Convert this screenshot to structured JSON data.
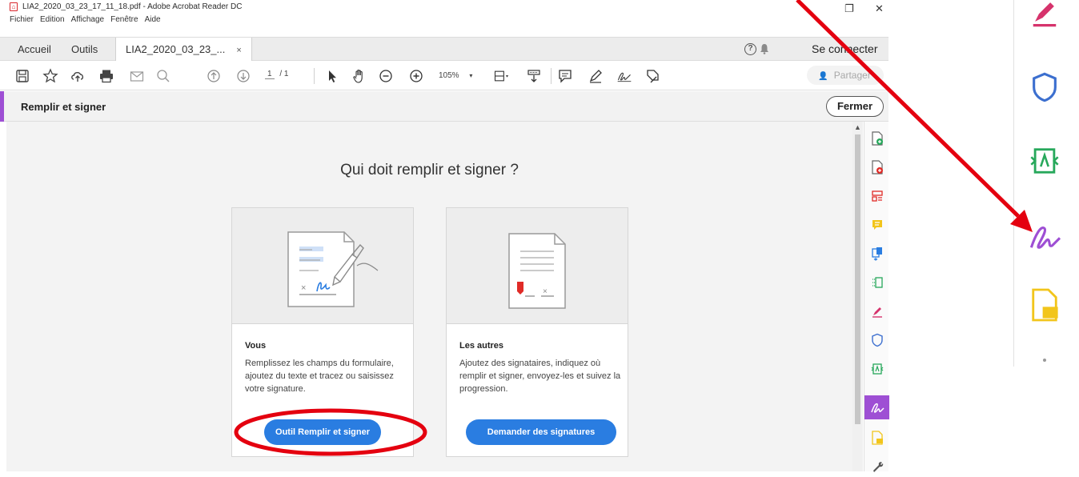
{
  "window": {
    "title": "LIA2_2020_03_23_17_11_18.pdf - Adobe Acrobat Reader DC",
    "pdf_icon": "pdf-file-icon",
    "restore_glyph": "❐",
    "close_glyph": "✕"
  },
  "menu": [
    "Fichier",
    "Edition",
    "Affichage",
    "Fenêtre",
    "Aide"
  ],
  "tabs": {
    "home": "Accueil",
    "tools": "Outils",
    "document": "LIA2_2020_03_23_...",
    "document_close": "×"
  },
  "header": {
    "help_glyph": "?",
    "connect_label": "Se connecter"
  },
  "toolbar": {
    "page_current": "1",
    "page_total": "/ 1",
    "zoom": "105%",
    "share_label": "Partager"
  },
  "mode": {
    "title": "Remplir et signer",
    "close_label": "Fermer"
  },
  "main": {
    "question": "Qui doit remplir et signer ?",
    "cards": [
      {
        "title": "Vous",
        "description": "Remplissez les champs du formulaire, ajoutez du texte et tracez ou saisissez votre signature.",
        "button": "Outil Remplir et signer"
      },
      {
        "title": "Les autres",
        "description": "Ajoutez des signataires, indiquez où remplir et signer, envoyez-les et suivez la progression.",
        "button": "Demander des signatures"
      }
    ]
  },
  "colors": {
    "accent_purple": "#9e4fd4",
    "primary_blue": "#2a7de1",
    "annotation_red": "#e4000f",
    "fill_sign_pink": "#d6336c",
    "export_green": "#27a85b",
    "comment_yellow": "#f2c51b",
    "protect_blue": "#3c6fcf"
  },
  "rail_icons": [
    "create-pdf-icon",
    "export-pdf-icon",
    "organize-pages-icon",
    "comment-icon",
    "combine-files-icon",
    "edit-pdf-icon",
    "fill-sign-icon",
    "protect-icon",
    "adobe-sign-icon",
    "fill-sign-selected-icon",
    "send-comment-icon",
    "more-tools-icon"
  ]
}
